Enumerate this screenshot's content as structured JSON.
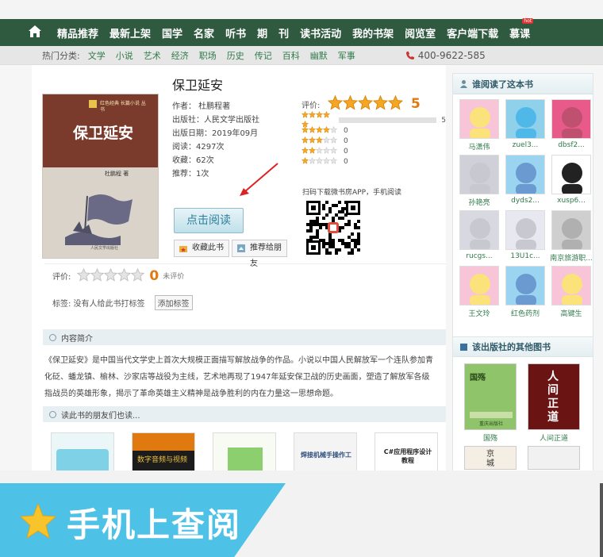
{
  "nav": {
    "items": [
      "精品推荐",
      "最新上架",
      "国学",
      "名家",
      "听书",
      "期",
      "刊",
      "读书活动",
      "我的书架",
      "阅览室",
      "客户端下载",
      "慕课"
    ],
    "hot_badge": "hot"
  },
  "subnav": {
    "label": "热门分类:",
    "categories": [
      "文学",
      "小说",
      "艺术",
      "经济",
      "职场",
      "历史",
      "传记",
      "百科",
      "幽默",
      "军事"
    ],
    "phone": "400-9622-585"
  },
  "book": {
    "title": "保卫延安",
    "author": "作者：  杜鹏程著",
    "publisher": "出版社：人民文学出版社",
    "pub_date": "出版日期：2019年09月",
    "reads": "阅读：4297次",
    "favorites": "收藏：62次",
    "recommends": "推荐：1次",
    "cover_title": "保卫延安",
    "cover_sub": "杜鹏程 著",
    "cover_strip": "红色经典 长篇小说 丛书",
    "cover_pub": "人民文学出版社"
  },
  "rating": {
    "label": "评价:",
    "score": "5",
    "distribution": [
      {
        "stars": 5,
        "count": "5",
        "fraction": 1.0
      },
      {
        "stars": 4,
        "count": "0",
        "fraction": 0
      },
      {
        "stars": 3,
        "count": "0",
        "fraction": 0
      },
      {
        "stars": 2,
        "count": "0",
        "fraction": 0
      },
      {
        "stars": 1,
        "count": "0",
        "fraction": 0
      }
    ]
  },
  "qr_text": "扫码下载微书房APP，手机阅读",
  "buttons": {
    "read": "点击阅读",
    "favorite": "收藏此书",
    "recommend": "推荐给朋友",
    "add_tag": "添加标签"
  },
  "user_rating": {
    "label": "评价:",
    "score": "0",
    "status": "未评价"
  },
  "tags_text": "标签: 没有人给此书打标签",
  "sections": {
    "intro": "内容简介",
    "friends": "读此书的朋友们也读..."
  },
  "description": "《保卫延安》是中国当代文学史上首次大规模正面描写解放战争的作品。小说以中国人民解放军一个连队参加青化砭、蟠龙镇、榆林、沙家店等战役为主线，艺术地再现了1947年延安保卫战的历史画面，塑造了解放军各级指战员的英雄形象，揭示了革命英雄主义精神是战争胜利的内在力量这一思想命题。",
  "thumbs": [
    {
      "text": ""
    },
    {
      "text": "数字音频与视频"
    },
    {
      "text": ""
    },
    {
      "text": "焊接机械手操作工"
    },
    {
      "text": "C#应用程序设计教程"
    }
  ],
  "sidebar": {
    "readers_title": "谁阅读了这本书",
    "readers": [
      "马潇伟",
      "zuel3...",
      "dbsf2...",
      "孙艳亮",
      "dyds2...",
      "xusp6...",
      "rucgs...",
      "13U1c...",
      "南京旅游职...",
      "王文玲",
      "红色药剂",
      "高键生"
    ],
    "publisher_title": "该出版社的其他图书",
    "publisher_books": [
      {
        "name": "国殇",
        "cover_title": "国殇",
        "cover_pub": "重庆出版社"
      },
      {
        "name": "人间正道",
        "cover_title": "人间正道"
      }
    ],
    "more_books": [
      "京城"
    ]
  },
  "banner": {
    "text": "手机上查阅"
  },
  "colors": {
    "nav_bg": "#2f5a40",
    "accent_orange": "#e07a10",
    "link_green": "#2f7a4a",
    "banner_blue": "#4ec1e6"
  }
}
